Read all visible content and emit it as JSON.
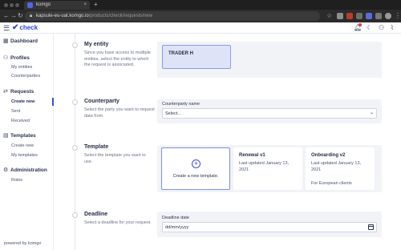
{
  "browser": {
    "tab_title": "komgo",
    "tab_close": "×",
    "new_tab": "+",
    "url_host": "kapsule-eu-uat.komgo.io",
    "url_path": "/products/check/requests/new"
  },
  "app": {
    "logo_text": "check",
    "notification_count": "1"
  },
  "sidebar": {
    "dashboard": "Dashboard",
    "profiles": {
      "label": "Profiles",
      "items": [
        "My entities",
        "Counterparties"
      ]
    },
    "requests": {
      "label": "Requests",
      "items": [
        "Create new",
        "Sent",
        "Received"
      ],
      "active": "Create new"
    },
    "templates": {
      "label": "Templates",
      "items": [
        "Create new",
        "My templates"
      ]
    },
    "administration": {
      "label": "Administration",
      "items": [
        "Roles"
      ]
    },
    "powered_by": "powered by komgo"
  },
  "form": {
    "my_entity": {
      "title": "My entity",
      "description": "Since you have access to multiple entities, select the entity to which the request is associated.",
      "selected_entity": "TRADER H"
    },
    "counterparty": {
      "title": "Counterparty",
      "description": "Select the party you want to request data from.",
      "field_label": "Counterparty name",
      "placeholder": "Select..."
    },
    "template": {
      "title": "Template",
      "description": "Select the template you want to use.",
      "create_new_label": "Create a new template.",
      "cards": [
        {
          "title": "Renewal v1",
          "updated": "Last updated January 13, 2021",
          "description": ""
        },
        {
          "title": "Onboarding v2",
          "updated": "Last updated January 13, 2021",
          "description": "For European clients"
        }
      ]
    },
    "deadline": {
      "title": "Deadline",
      "description": "Select a deadline for your request.",
      "field_label": "Deadline date",
      "placeholder": "dd/mm/yyyy"
    }
  },
  "colors": {
    "brand": "#2f45d6",
    "selected_card_bg": "#dfe3f8",
    "panel_bg": "#f2f3f7",
    "notification": "#e23b3b"
  }
}
